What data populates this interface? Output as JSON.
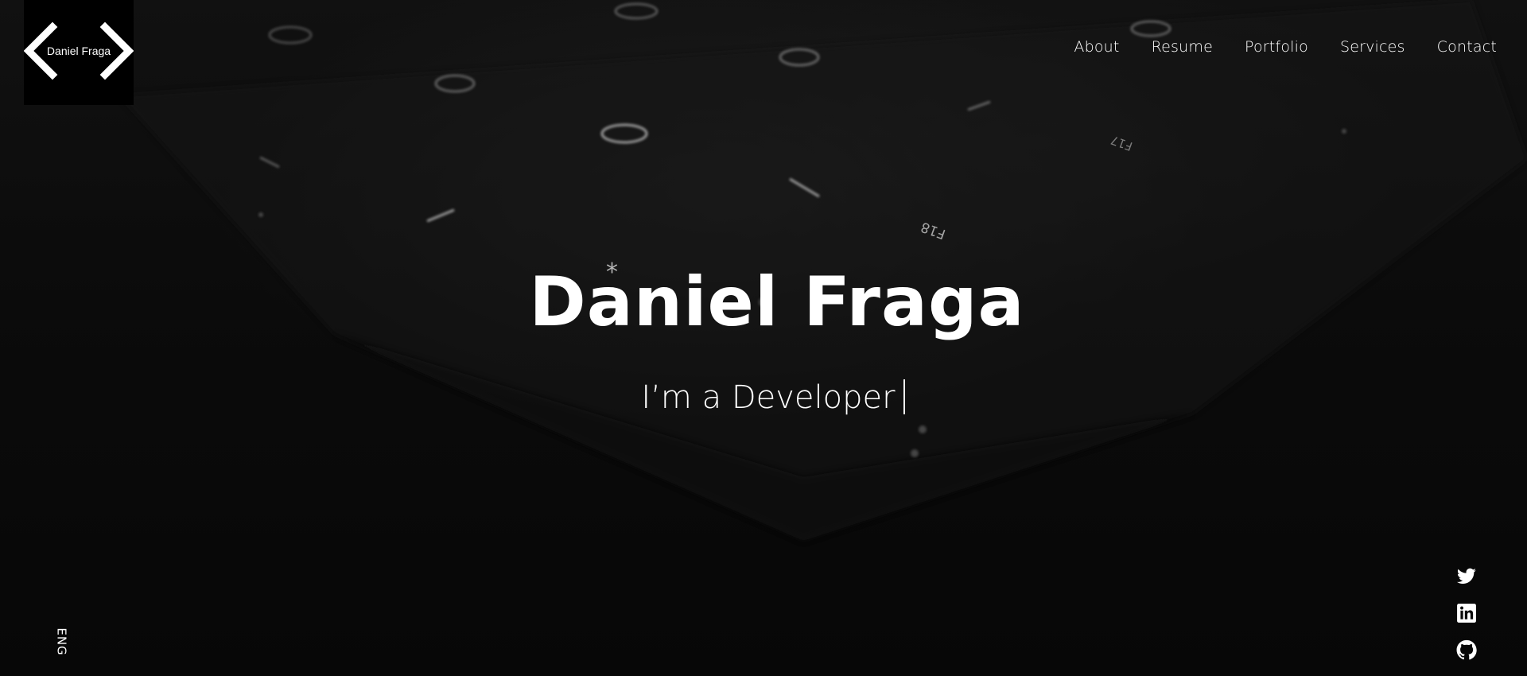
{
  "logo": {
    "text": "Daniel Fraga"
  },
  "nav": {
    "items": [
      {
        "label": "About"
      },
      {
        "label": "Resume"
      },
      {
        "label": "Portfolio"
      },
      {
        "label": "Services"
      },
      {
        "label": "Contact"
      }
    ]
  },
  "hero": {
    "title": "Daniel Fraga",
    "subtitle": "I’m a Developer"
  },
  "language": {
    "label": "ENG"
  },
  "social": {
    "icons": [
      "twitter-icon",
      "linkedin-icon",
      "github-icon"
    ]
  },
  "colors": {
    "background": "#080808",
    "text": "#ffffff"
  }
}
